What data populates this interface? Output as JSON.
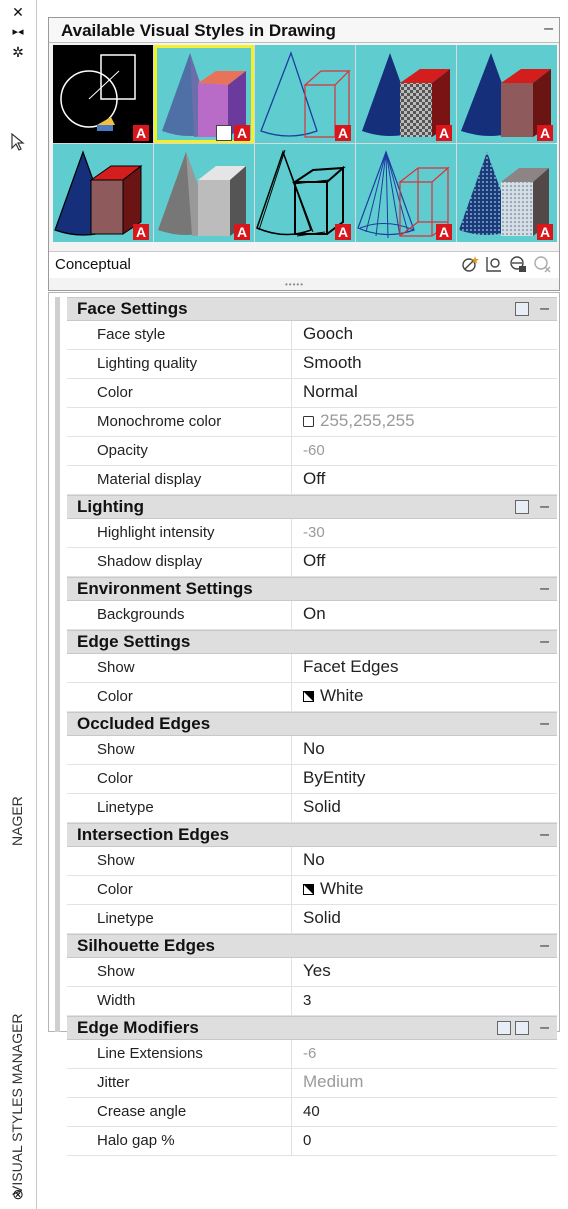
{
  "palette": {
    "title": "VISUAL STYLES MANAGER",
    "title_fragment": "NAGER",
    "buttons": {
      "close": "close-icon",
      "autohide": "autohide-icon",
      "properties": "properties-icon"
    }
  },
  "gallery": {
    "title": "Available Visual Styles in Drawing",
    "collapse": "–",
    "current_style": "Conceptual",
    "thumb_badge": "A",
    "styles_count": 10,
    "selected_index": 1,
    "tool_icons": [
      "create-style-icon",
      "apply-to-viewport-icon",
      "export-to-palette-icon",
      "delete-style-icon"
    ]
  },
  "sections": [
    {
      "title": "Face Settings",
      "collapse": "–",
      "icons": 1,
      "rows": [
        {
          "label": "Face style",
          "value": "Gooch"
        },
        {
          "label": "Lighting quality",
          "value": "Smooth"
        },
        {
          "label": "Color",
          "value": "Normal"
        },
        {
          "label": "Monochrome color",
          "value": "255,255,255",
          "dim": true,
          "swatch": "#ffffff"
        },
        {
          "label": "Opacity",
          "value": "-60",
          "dim": true,
          "small": true
        },
        {
          "label": "Material display",
          "value": "Off"
        }
      ]
    },
    {
      "title": "Lighting",
      "collapse": "–",
      "icons": 1,
      "rows": [
        {
          "label": "Highlight intensity",
          "value": "-30",
          "dim": true,
          "small": true
        },
        {
          "label": "Shadow display",
          "value": "Off"
        }
      ]
    },
    {
      "title": "Environment Settings",
      "collapse": "–",
      "icons": 0,
      "rows": [
        {
          "label": "Backgrounds",
          "value": "On"
        }
      ]
    },
    {
      "title": "Edge Settings",
      "collapse": "–",
      "icons": 0,
      "rows": [
        {
          "label": "Show",
          "value": "Facet Edges"
        },
        {
          "label": "Color",
          "value": "White",
          "swatch": "bw"
        }
      ]
    },
    {
      "title": "Occluded Edges",
      "collapse": "–",
      "icons": 0,
      "rows": [
        {
          "label": "Show",
          "value": "No"
        },
        {
          "label": "Color",
          "value": "ByEntity"
        },
        {
          "label": "Linetype",
          "value": "Solid"
        }
      ]
    },
    {
      "title": "Intersection Edges",
      "collapse": "–",
      "icons": 0,
      "rows": [
        {
          "label": "Show",
          "value": "No"
        },
        {
          "label": "Color",
          "value": "White",
          "swatch": "bw"
        },
        {
          "label": "Linetype",
          "value": "Solid"
        }
      ]
    },
    {
      "title": "Silhouette Edges",
      "collapse": "–",
      "icons": 0,
      "rows": [
        {
          "label": "Show",
          "value": "Yes"
        },
        {
          "label": "Width",
          "value": "3",
          "small": true
        }
      ]
    },
    {
      "title": "Edge Modifiers",
      "collapse": "–",
      "icons": 2,
      "rows": [
        {
          "label": "Line Extensions",
          "value": "-6",
          "dim": true,
          "small": true
        },
        {
          "label": "Jitter",
          "value": "Medium",
          "dim": true
        },
        {
          "label": "Crease angle",
          "value": "40",
          "small": true
        },
        {
          "label": "Halo gap %",
          "value": "0",
          "small": true
        }
      ]
    }
  ]
}
